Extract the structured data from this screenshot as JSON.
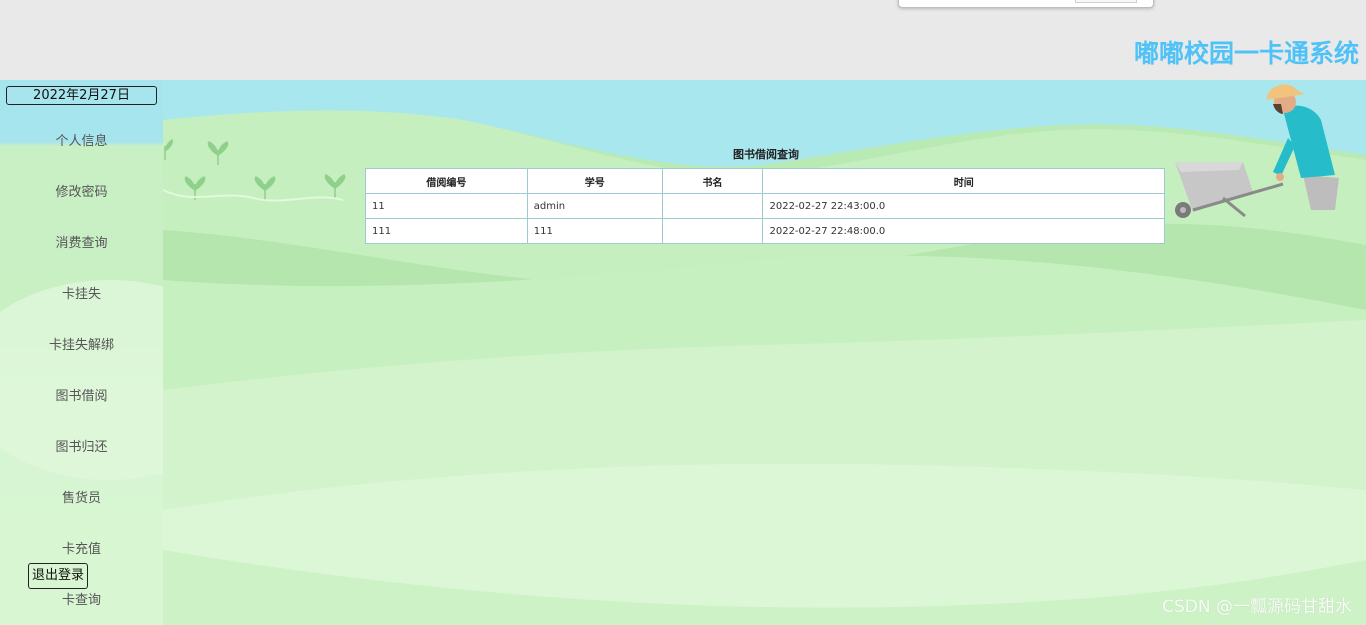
{
  "app": {
    "title": "嘟嘟校园一卡通系统"
  },
  "sidebar": {
    "date": "2022年2月27日",
    "items": [
      {
        "label": "个人信息"
      },
      {
        "label": "修改密码"
      },
      {
        "label": "消费查询"
      },
      {
        "label": "卡挂失"
      },
      {
        "label": "卡挂失解绑"
      },
      {
        "label": "图书借阅"
      },
      {
        "label": "图书归还"
      },
      {
        "label": "售货员"
      },
      {
        "label": "卡充值"
      },
      {
        "label": "卡查询"
      }
    ],
    "logout_label": "退出登录"
  },
  "main": {
    "table_title": "图书借阅查询",
    "columns": [
      "借阅编号",
      "学号",
      "书名",
      "时间"
    ],
    "rows": [
      [
        "11",
        "admin",
        "",
        "2022-02-27 22:43:00.0"
      ],
      [
        "111",
        "111",
        "",
        "2022-02-27 22:48:00.0"
      ]
    ]
  },
  "watermark": "CSDN @一瓢源码甘甜水",
  "colors": {
    "title": "#4fc3f7",
    "sky": "#a7e5ee",
    "grass": "#c8f0c3",
    "table_border": "#9fc9d2"
  }
}
